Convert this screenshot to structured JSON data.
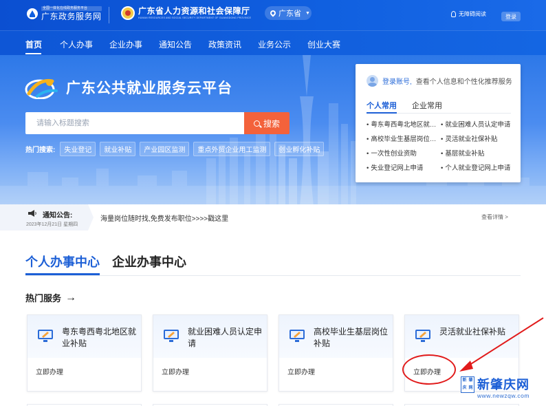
{
  "header": {
    "gov_logo_tiny": "全国一体化在线政务服务平台",
    "gov_logo_name": "广东政务服务网",
    "dept_name": "广东省人力资源和社会保障厅",
    "dept_name_en": "HUMAN RESOURCES AND SOCIAL SECURITY DEPARTMENT OF GUANGDONG PROVINCE",
    "region": "广东省",
    "accessibility": "无障碍阅读",
    "login": "登录"
  },
  "nav": {
    "items": [
      "首页",
      "个人办事",
      "企业办事",
      "通知公告",
      "政策资讯",
      "业务公示",
      "创业大赛"
    ],
    "active": "首页"
  },
  "hero": {
    "title": "广东公共就业服务云平台",
    "search_placeholder": "请输入标题搜索",
    "search_button": "搜索",
    "hot_label": "热门搜索:",
    "hot_tags": [
      "失业登记",
      "就业补贴",
      "产业园区监测",
      "重点外贸企业用工监测",
      "创业孵化补贴"
    ]
  },
  "panel": {
    "login_link": "登录账号,",
    "login_hint": "查看个人信息和个性化推荐服务",
    "tabs": [
      "个人常用",
      "企业常用"
    ],
    "items": [
      "粤东粤西粤北地区就业补贴",
      "就业困难人员认定申请",
      "高校毕业生基层岗位补贴",
      "灵活就业社保补贴",
      "一次性创业资助",
      "基层就业补贴",
      "失业登记网上申请",
      "个人就业登记网上申请"
    ]
  },
  "notice": {
    "label": "通知公告:",
    "date": "2023年12月21日  星期四",
    "message": "海量岗位随时找,免费发布职位>>>>戳这里",
    "more": "查看详情 >"
  },
  "center": {
    "tabs": [
      "个人办事中心",
      "企业办事中心"
    ],
    "hot_title": "热门服务",
    "cards": [
      {
        "title": "粤东粤西粤北地区就业补贴",
        "action": "立即办理"
      },
      {
        "title": "就业困难人员认定申请",
        "action": "立即办理"
      },
      {
        "title": "高校毕业生基层岗位补贴",
        "action": "立即办理"
      },
      {
        "title": "灵活就业社保补贴",
        "action": "立即办理"
      }
    ]
  },
  "watermark": {
    "box": [
      "新",
      "肇",
      "庆",
      "网"
    ],
    "name": "新肇庆网",
    "url": "www.newzqw.com"
  },
  "colors": {
    "primary": "#1c5fd6",
    "header": "#0b4fd1",
    "search_button": "#f3623b",
    "annotation": "#e11b1b"
  }
}
